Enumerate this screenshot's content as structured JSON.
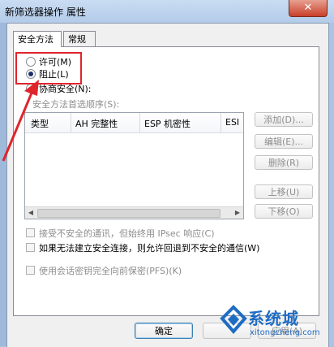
{
  "window": {
    "title": "新筛选器操作 属性",
    "close_label": "✕"
  },
  "tabs": [
    {
      "label": "安全方法"
    },
    {
      "label": "常规"
    }
  ],
  "radios": {
    "permit": "许可(M)",
    "block": "阻止(L)",
    "negotiate": "协商安全(N):",
    "selected": "block"
  },
  "order_label": "安全方法首选顺序(S):",
  "columns": [
    "类型",
    "AH 完整性",
    "ESP 机密性",
    "ESI"
  ],
  "side_buttons": {
    "add": "添加(D)...",
    "edit": "编辑(E)...",
    "remove": "删除(R)",
    "up": "上移(U)",
    "down": "下移(O)"
  },
  "options": {
    "accept_insecure": "接受不安全的通讯，但始终用 IPsec 响应(C)",
    "fallback": "如果无法建立安全连接，则允许回退到不安全的通信(W)",
    "pfs": "使用会话密钥完全向前保密(PFS)(K)"
  },
  "footer": {
    "ok": "确定",
    "apply": "应用(A)"
  },
  "watermark": {
    "brand": "系统城",
    "url": "xitongcheng.com"
  },
  "colors": {
    "annotation_red": "#e0242c",
    "watermark_blue": "#1f6cc4"
  }
}
